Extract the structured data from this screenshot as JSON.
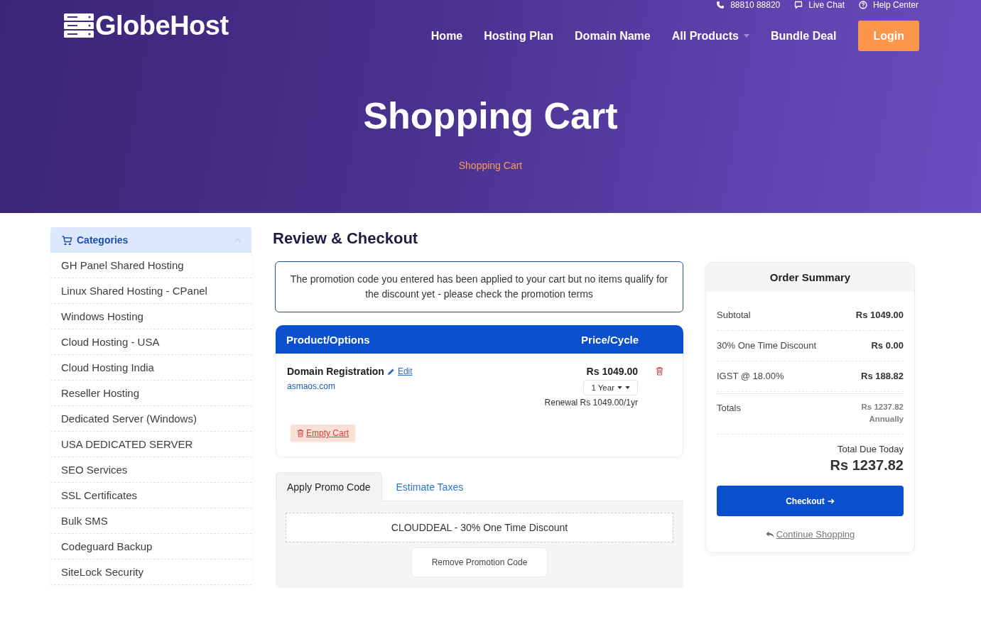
{
  "top_bar": {
    "items": [
      {
        "kind": "phone",
        "label": "88810 88820"
      },
      {
        "kind": "chat",
        "label": "Live Chat"
      },
      {
        "kind": "help",
        "label": "Help Center"
      }
    ]
  },
  "header": {
    "logo": "GlobeHost",
    "nav": [
      {
        "label": "Home",
        "dropdown": false
      },
      {
        "label": "Hosting Plan",
        "dropdown": false
      },
      {
        "label": "Domain Name",
        "dropdown": false
      },
      {
        "label": "All Products",
        "dropdown": true
      },
      {
        "label": "Bundle Deal",
        "dropdown": false
      }
    ],
    "login": "Login"
  },
  "hero": {
    "title": "Shopping Cart",
    "breadcrumb": "Shopping Cart"
  },
  "sidebar": {
    "title": "Categories",
    "expanded": true,
    "items": [
      "GH Panel Shared Hosting",
      "Linux Shared Hosting - CPanel",
      "Windows Hosting",
      "Cloud Hosting - USA",
      "Cloud Hosting India",
      "Reseller Hosting",
      "Dedicated Server (Windows)",
      "USA DEDICATED SERVER",
      "SEO Services",
      "SSL Certificates",
      "Bulk SMS",
      "Codeguard Backup",
      "SiteLock Security"
    ]
  },
  "main": {
    "heading": "Review & Checkout",
    "alert": "The promotion code you entered has been applied to your cart but no items qualify for the discount yet - please check the promotion terms",
    "cart": {
      "columns": [
        "Product/Options",
        "Price/Cycle"
      ],
      "items": [
        {
          "name": "Domain Registration",
          "edit": "Edit",
          "domain": "asmaos.com",
          "price": "Rs 1049.00",
          "cycle": "1 Year",
          "renewal": "Renewal Rs 1049.00/1yr"
        }
      ],
      "empty_cart": "Empty Cart"
    },
    "tabs": [
      {
        "label": "Apply Promo Code",
        "selected": true
      },
      {
        "label": "Estimate Taxes",
        "selected": false
      }
    ],
    "promo": {
      "value": "CLOUDDEAL - 30% One Time Discount",
      "remove": "Remove Promotion Code"
    }
  },
  "summary": {
    "title": "Order Summary",
    "rows": [
      {
        "label": "Subtotal",
        "value": "Rs 1049.00"
      },
      {
        "label": "30% One Time Discount",
        "value": "Rs 0.00"
      },
      {
        "label": "IGST @ 18.00%",
        "value": "Rs 188.82"
      }
    ],
    "totals": {
      "label": "Totals",
      "value": "Rs 1237.82",
      "cycle": "Annually"
    },
    "due_label": "Total Due Today",
    "due_value": "Rs 1237.82",
    "checkout": "Checkout",
    "continue": "Continue Shopping"
  }
}
